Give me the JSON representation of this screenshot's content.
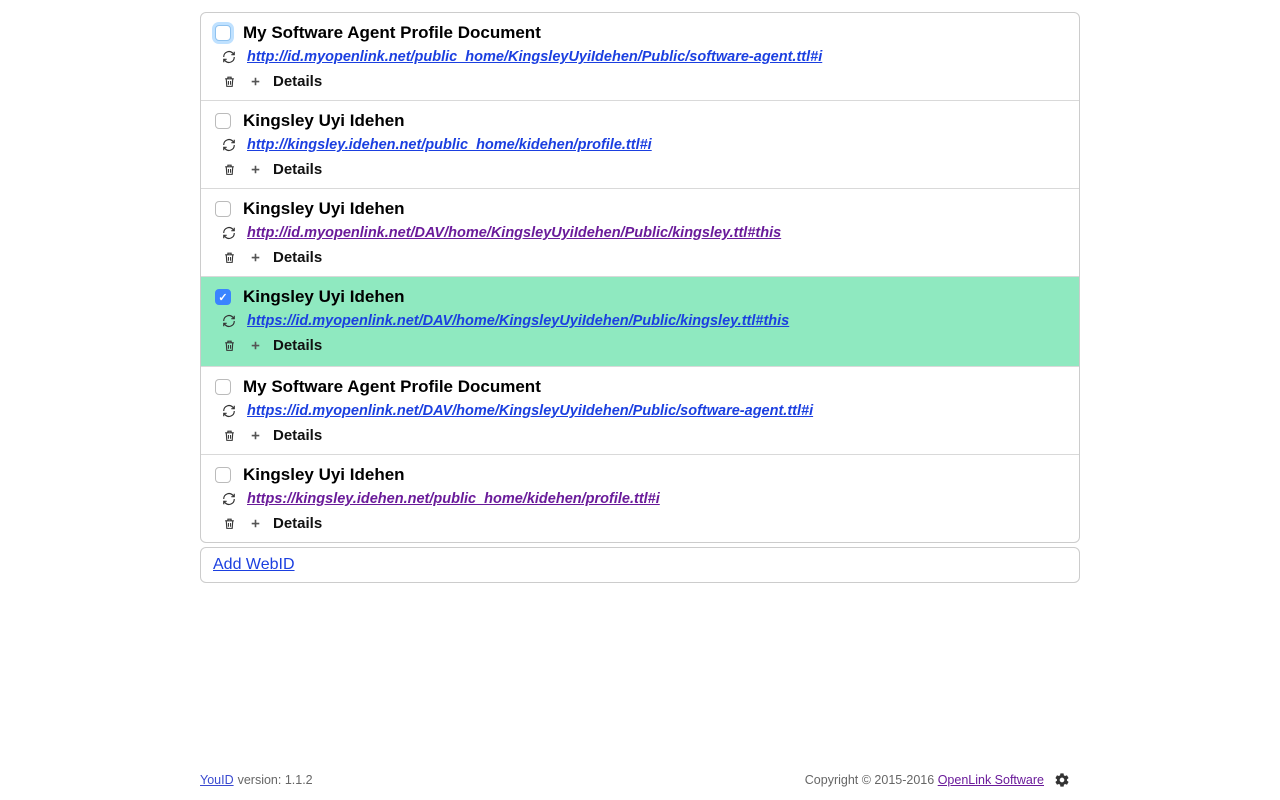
{
  "cards": [
    {
      "title": "My Software Agent Profile Document",
      "url": "http://id.myopenlink.net/public_home/KingsleyUyiIdehen/Public/software-agent.ttl#i",
      "url_color": "blue",
      "checked": false,
      "focused": true,
      "selected": false,
      "details_label": "Details"
    },
    {
      "title": "Kingsley Uyi Idehen",
      "url": "http://kingsley.idehen.net/public_home/kidehen/profile.ttl#i",
      "url_color": "blue",
      "checked": false,
      "focused": false,
      "selected": false,
      "details_label": "Details"
    },
    {
      "title": "Kingsley Uyi Idehen",
      "url": "http://id.myopenlink.net/DAV/home/KingsleyUyiIdehen/Public/kingsley.ttl#this",
      "url_color": "purple",
      "checked": false,
      "focused": false,
      "selected": false,
      "details_label": "Details"
    },
    {
      "title": "Kingsley Uyi Idehen",
      "url": "https://id.myopenlink.net/DAV/home/KingsleyUyiIdehen/Public/kingsley.ttl#this",
      "url_color": "blue",
      "checked": true,
      "focused": false,
      "selected": true,
      "details_label": "Details"
    },
    {
      "title": "My Software Agent Profile Document",
      "url": "https://id.myopenlink.net/DAV/home/KingsleyUyiIdehen/Public/software-agent.ttl#i",
      "url_color": "blue",
      "checked": false,
      "focused": false,
      "selected": false,
      "details_label": "Details"
    },
    {
      "title": "Kingsley Uyi Idehen",
      "url": "https://kingsley.idehen.net/public_home/kidehen/profile.ttl#i",
      "url_color": "purple",
      "checked": false,
      "focused": false,
      "selected": false,
      "details_label": "Details"
    }
  ],
  "add_webid_label": "Add WebID",
  "footer": {
    "youid_label": "YouID",
    "version_label": "version: 1.1.2",
    "copyright": "Copyright © 2015-2016 ",
    "openlink_label": "OpenLink Software"
  }
}
